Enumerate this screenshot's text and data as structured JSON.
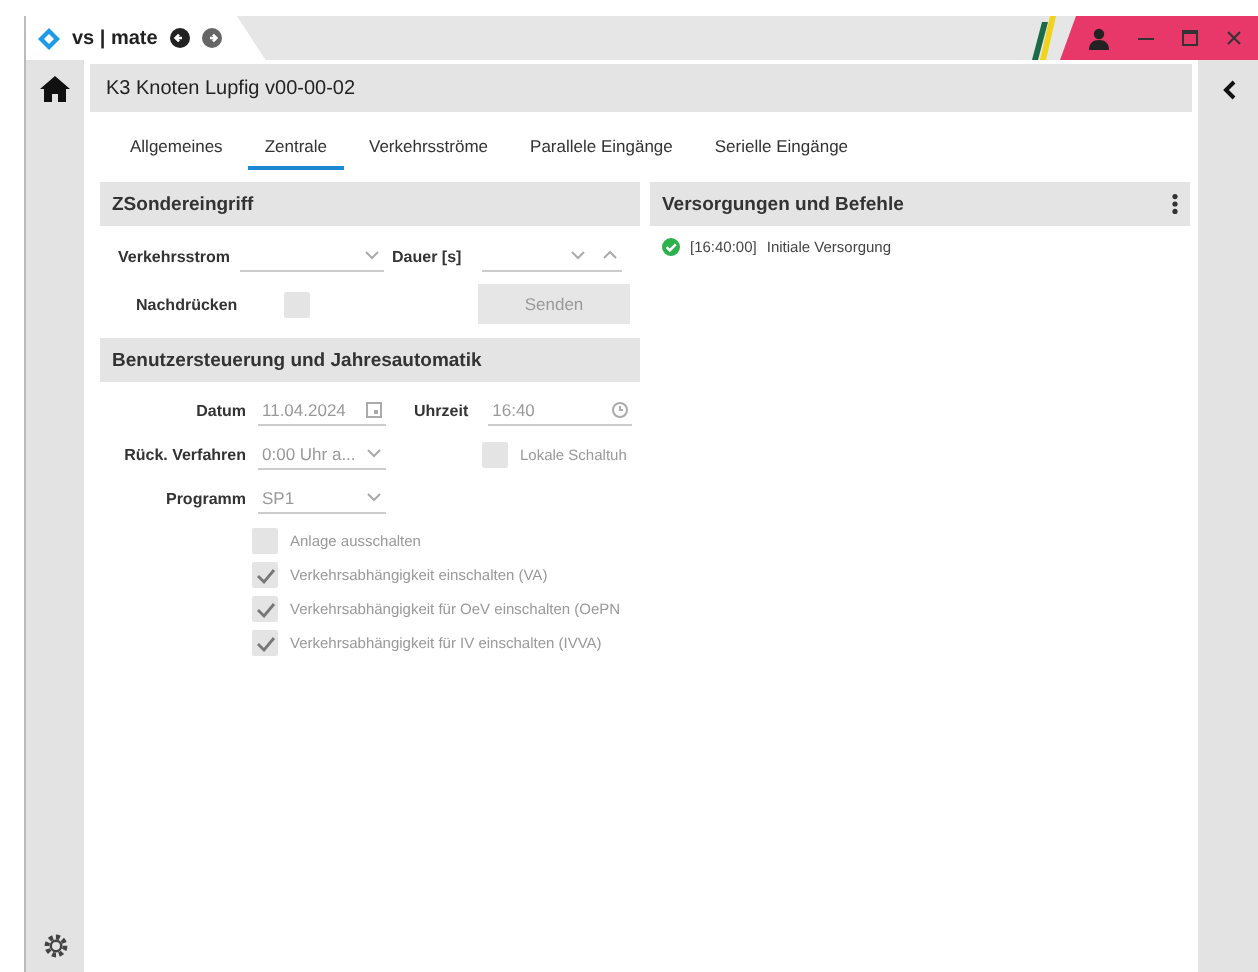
{
  "window": {
    "tab_title": "vs | mate"
  },
  "header": {
    "title": "K3 Knoten Lupfig v00-00-02"
  },
  "tabs": [
    {
      "label": "Allgemeines",
      "selected": false
    },
    {
      "label": "Zentrale",
      "selected": true
    },
    {
      "label": "Verkehrsströme",
      "selected": false
    },
    {
      "label": "Parallele Eingänge",
      "selected": false
    },
    {
      "label": "Serielle Eingänge",
      "selected": false
    }
  ],
  "sondereingriff": {
    "title": "ZSondereingriff",
    "verkehrsstrom_label": "Verkehrsstrom",
    "dauer_label": "Dauer [s]",
    "nachdruecken": {
      "label": "Nachdrücken",
      "checked": false
    },
    "send_button": {
      "label": "Senden",
      "disabled": true
    }
  },
  "benutzersteuerung": {
    "title": "Benutzersteuerung und Jahresautomatik",
    "datum": {
      "label": "Datum",
      "value": "11.04.2024"
    },
    "uhrzeit": {
      "label": "Uhrzeit",
      "value": "16:40"
    },
    "rueck_verfahren": {
      "label": "Rück. Verfahren",
      "value": "0:00 Uhr a..."
    },
    "lokale_schaltuhr": {
      "label": "Lokale Schaltuh",
      "checked": false
    },
    "programm": {
      "label": "Programm",
      "value": "SP1"
    },
    "options": [
      {
        "label": "Anlage ausschalten",
        "checked": false
      },
      {
        "label": "Verkehrsabhängigkeit einschalten (VA)",
        "checked": true
      },
      {
        "label": "Verkehrsabhängigkeit für OeV einschalten (OePN",
        "checked": true
      },
      {
        "label": "Verkehrsabhängigkeit für IV einschalten (IVVA)",
        "checked": true
      }
    ]
  },
  "versorgungen": {
    "title": "Versorgungen und Befehle",
    "entries": [
      {
        "time": "[16:40:00]",
        "text": "Initiale Versorgung",
        "color": "#2bb24c"
      }
    ]
  }
}
